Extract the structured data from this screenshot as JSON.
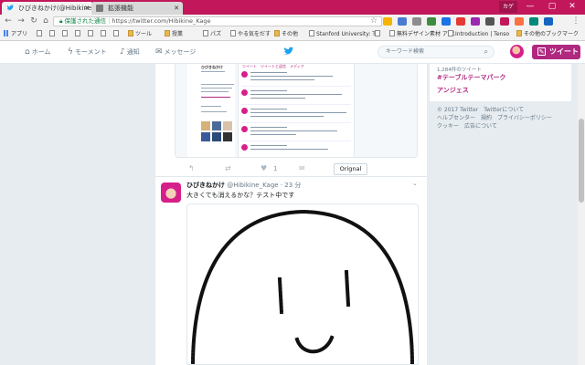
{
  "browser": {
    "tabs": [
      {
        "label": "ひびきねかけ(@Hibikine_K",
        "icon": "twitter-bird-icon",
        "active": true
      },
      {
        "label": "拡張機能",
        "icon": "puzzle-icon",
        "active": false
      }
    ],
    "user_chip": "カゲ",
    "window_controls": {
      "minimize": "—",
      "maximize": "▢",
      "close": "✕"
    },
    "url": {
      "secure_label": "保護された通信",
      "address": "https://twitter.com/Hibikine_Kage"
    },
    "bookmarks": [
      {
        "label": "アプリ",
        "icon": "apps-icon",
        "kind": "app"
      },
      {
        "label": "",
        "icon": "page-icon",
        "kind": "page"
      },
      {
        "label": "",
        "icon": "page-icon",
        "kind": "page"
      },
      {
        "label": "",
        "icon": "page-icon",
        "kind": "page"
      },
      {
        "label": "",
        "icon": "page-icon",
        "kind": "page"
      },
      {
        "label": "",
        "icon": "page-icon",
        "kind": "page"
      },
      {
        "label": "",
        "icon": "page-icon",
        "kind": "page"
      },
      {
        "label": "",
        "icon": "page-icon",
        "kind": "page"
      },
      {
        "label": "ツール",
        "icon": "folder-icon",
        "kind": "folder"
      },
      {
        "label": "授業",
        "icon": "folder-icon",
        "kind": "folder"
      },
      {
        "label": "パズ",
        "icon": "gear-icon",
        "kind": "page"
      },
      {
        "label": "やる気をだす",
        "icon": "page-icon",
        "kind": "page"
      },
      {
        "label": "その他",
        "icon": "folder-icon",
        "kind": "folder"
      },
      {
        "label": "Stanford University: Tr",
        "icon": "page-icon",
        "kind": "page"
      },
      {
        "label": "",
        "icon": "page-icon",
        "kind": "page"
      },
      {
        "label": "無料デザイン素材 ア-ス",
        "icon": "page-icon",
        "kind": "page"
      },
      {
        "label": "Introduction | Tenso",
        "icon": "page-icon",
        "kind": "page"
      },
      {
        "label": "その他のブックマーク",
        "icon": "folder-icon",
        "kind": "folder"
      }
    ]
  },
  "twitter_nav": {
    "home": "ホーム",
    "moments": "モーメント",
    "notifications": "通知",
    "messages": "メッセージ",
    "search_placeholder": "キーワード検索",
    "tweet_button": "ツイート"
  },
  "timeline": {
    "tweet1": {
      "embedded_screenshot": {
        "name": "ひびきねかけ",
        "tabs": "ツイート　ツイートと返信　メディア"
      },
      "actions": {
        "reply_icon": "reply-icon",
        "retweet_icon": "retweet-icon",
        "like_icon": "heart-icon",
        "like_count": "1",
        "dm_icon": "envelope-icon"
      },
      "original_button": "Orignal"
    },
    "tweet2": {
      "name": "ひびきねかけ",
      "handle": "@Hibikine_Kage",
      "separator": "·",
      "time": "23 分",
      "text": "大きくても消えるかな？テスト中です"
    }
  },
  "sidebar": {
    "trend_count": "1,284件のツイート",
    "trends": [
      "#テーブルテーマパーク",
      "アンジェス"
    ],
    "footer": "© 2017 Twitter　Twitterについて\nヘルプセンター　規約　プライバシーポリシー\nクッキー　広告について"
  },
  "colors": {
    "accent": "#b0287f",
    "chrome_frame": "#c2185b",
    "link_blue": "#1da1f2"
  }
}
